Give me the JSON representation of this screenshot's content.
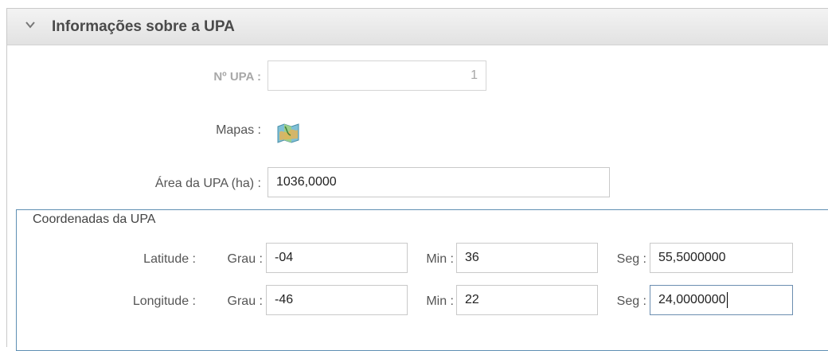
{
  "section": {
    "title": "Informações sobre a UPA"
  },
  "upa_number": {
    "label": "Nº UPA :",
    "value": "1"
  },
  "maps": {
    "label": "Mapas :",
    "icon": "map-icon"
  },
  "area": {
    "label": "Área da UPA (ha) :",
    "value": "1036,0000"
  },
  "coordinates": {
    "legend": "Coordenadas da UPA",
    "latitude": {
      "label": "Latitude :",
      "grau_label": "Grau :",
      "grau": "-04",
      "min_label": "Min :",
      "min": "36",
      "seg_label": "Seg :",
      "seg": "55,5000000"
    },
    "longitude": {
      "label": "Longitude :",
      "grau_label": "Grau :",
      "grau": "-46",
      "min_label": "Min :",
      "min": "22",
      "seg_label": "Seg :",
      "seg": "24,0000000"
    }
  },
  "colors": {
    "fieldset_border": "#5f8fb3",
    "header_bg": "#e8e8e8"
  }
}
